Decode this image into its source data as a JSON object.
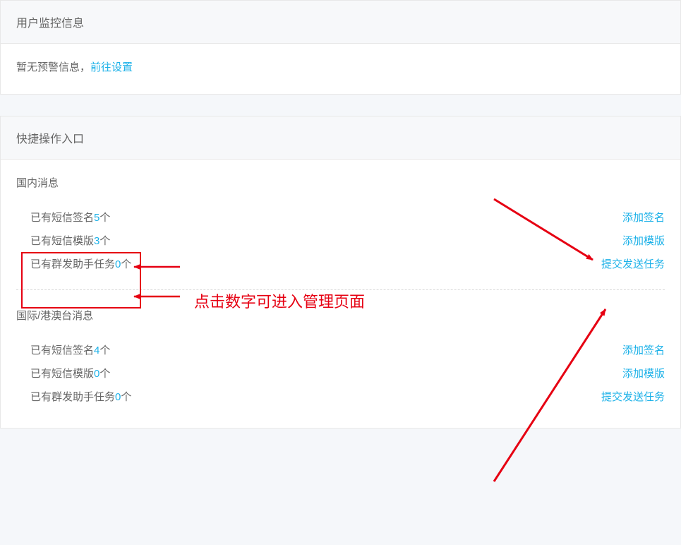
{
  "user_monitor": {
    "title": "用户监控信息",
    "empty_text": "暂无预警信息，",
    "setup_link": "前往设置"
  },
  "quick_ops": {
    "title": "快捷操作入口",
    "domestic": {
      "section_title": "国内消息",
      "rows": [
        {
          "prefix": "已有短信签名",
          "count": "5",
          "unit": "个",
          "action": "添加签名"
        },
        {
          "prefix": "已有短信模版",
          "count": "3",
          "unit": "个",
          "action": "添加模版"
        },
        {
          "prefix": "已有群发助手任务",
          "count": "0",
          "unit": "个",
          "action": "提交发送任务"
        }
      ]
    },
    "intl": {
      "section_title": "国际/港澳台消息",
      "rows": [
        {
          "prefix": "已有短信签名",
          "count": "4",
          "unit": "个",
          "action": "添加签名"
        },
        {
          "prefix": "已有短信模版",
          "count": "0",
          "unit": "个",
          "action": "添加模版"
        },
        {
          "prefix": "已有群发助手任务",
          "count": "0",
          "unit": "个",
          "action": "提交发送任务"
        }
      ]
    }
  },
  "annotation": {
    "hint": "点击数字可进入管理页面"
  }
}
